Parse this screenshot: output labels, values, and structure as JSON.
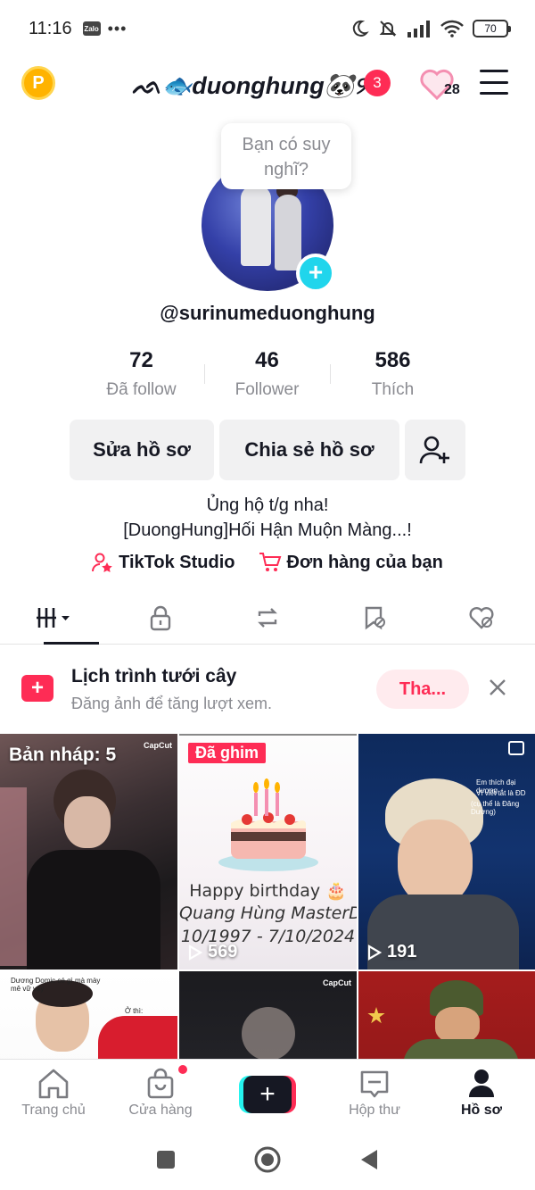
{
  "status_bar": {
    "time": "11:16",
    "notif_app": "Zalo",
    "more": "•••",
    "battery": "70"
  },
  "header": {
    "coin_label": "P",
    "title": "ᨒ🐟duonghung🐼୨ৎ",
    "notification_count": "3",
    "heart_count": "28"
  },
  "profile": {
    "thought_bubble": "Bạn có suy nghĩ?",
    "username": "@surinumeduonghung",
    "stats": [
      {
        "value": "72",
        "label": "Đã follow"
      },
      {
        "value": "46",
        "label": "Follower"
      },
      {
        "value": "586",
        "label": "Thích"
      }
    ],
    "buttons": {
      "edit": "Sửa hồ sơ",
      "share": "Chia sẻ hồ sơ"
    },
    "bio_line1": "Ủng hộ t/g nha!",
    "bio_line2": "[DuongHung]Hối Hận Muộn Màng...!",
    "links": {
      "studio": "TikTok Studio",
      "orders": "Đơn hàng của bạn"
    }
  },
  "tabs": [
    "videos-grid-icon",
    "lock-icon",
    "repost-icon",
    "bookmark-icon",
    "liked-icon"
  ],
  "banner": {
    "title": "Lịch trình tưới cây",
    "subtitle": "Đăng ảnh để tăng lượt xem.",
    "button": "Tha..."
  },
  "grid": {
    "drafts_label": "Bản nháp: 5",
    "pinned_label": "Đã ghim",
    "bday_line1": "Happy birthday 🎂",
    "bday_line2": "Quang Hùng MasterD",
    "bday_line3": "10/1997 - 7/10/2024",
    "video2_views": "569",
    "video3_views": "191",
    "capcut_label": "CapCut",
    "video3_caption1": "Em thích đại dương",
    "video3_caption2": "Vì viết tắt là ĐD",
    "video3_caption3": "(cụ thể là Đăng Dương)",
    "video4_caption1": "Dương Domic có gì mà mày mê vữ vậy",
    "video4_caption2": "Ở thì:"
  },
  "bottom_nav": {
    "home": "Trang chủ",
    "shop": "Cửa hàng",
    "create": "+",
    "inbox": "Hộp thư",
    "profile": "Hồ sơ"
  },
  "colors": {
    "accent": "#fe2c55",
    "cyan": "#25f4ee",
    "text": "#161823",
    "muted": "#8a8b91"
  }
}
